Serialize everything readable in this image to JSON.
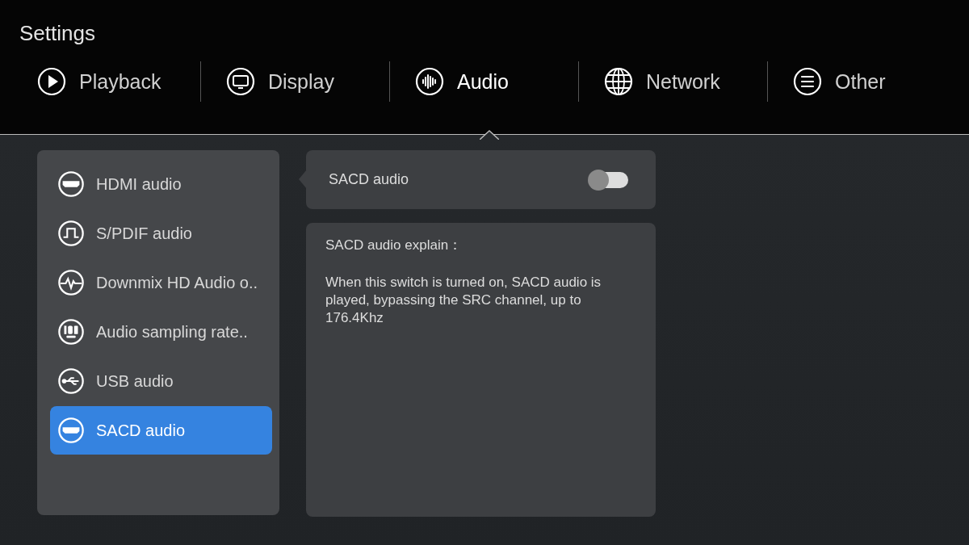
{
  "title": "Settings",
  "tabs": [
    {
      "label": "Playback",
      "selected": false
    },
    {
      "label": "Display",
      "selected": false
    },
    {
      "label": "Audio",
      "selected": true
    },
    {
      "label": "Network",
      "selected": false
    },
    {
      "label": "Other",
      "selected": false
    }
  ],
  "menu": [
    {
      "label": "HDMI audio",
      "selected": false
    },
    {
      "label": "S/PDIF audio",
      "selected": false
    },
    {
      "label": "Downmix HD Audio o..",
      "selected": false
    },
    {
      "label": "Audio sampling rate..",
      "selected": false
    },
    {
      "label": "USB audio",
      "selected": false
    },
    {
      "label": "SACD audio",
      "selected": true
    }
  ],
  "setting": {
    "label": "SACD audio",
    "on": false
  },
  "explain": {
    "heading": "SACD audio explain：",
    "text": "When this switch is turned on, SACD audio is played, bypassing the SRC channel, up to 176.4Khz"
  }
}
